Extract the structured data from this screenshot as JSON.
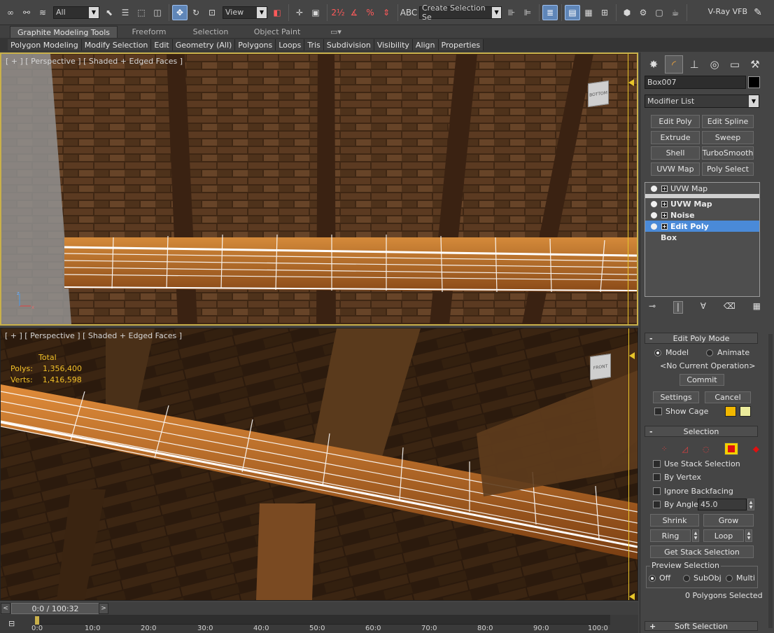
{
  "toolbar": {
    "selection_filter": "All",
    "ref_coord": "View",
    "named_selection_placeholder": "Create Selection Se",
    "vray_label": "V-Ray VFB"
  },
  "ribbon": {
    "tabs": [
      "Graphite Modeling Tools",
      "Freeform",
      "Selection",
      "Object Paint"
    ],
    "tools": [
      "Polygon Modeling",
      "Modify Selection",
      "Edit",
      "Geometry (All)",
      "Polygons",
      "Loops",
      "Tris",
      "Subdivision",
      "Visibility",
      "Align",
      "Properties"
    ]
  },
  "viewports": {
    "top_label": "[ + ] [ Perspective ] [ Shaded + Edged Faces ]",
    "bottom_label": "[ + ] [ Perspective ] [ Shaded + Edged Faces ]",
    "stats": {
      "total": "Total",
      "polys_label": "Polys:",
      "polys_value": "1,356,400",
      "verts_label": "Verts:",
      "verts_value": "1,416,598"
    },
    "top_cube": "BOTTOM",
    "bottom_cube": "FRONT"
  },
  "command_panel": {
    "object_name": "Box007",
    "modifier_list": "Modifier List",
    "modifier_buttons": [
      "Edit Poly",
      "Edit Spline",
      "Extrude",
      "Sweep",
      "Shell",
      "TurboSmooth",
      "UVW Map",
      "Poly Select"
    ],
    "stack": [
      {
        "label": "UVW Map",
        "style": "normal"
      },
      {
        "label": "UVW Map",
        "style": "bold"
      },
      {
        "label": "Noise",
        "style": "bold"
      },
      {
        "label": "Edit Poly",
        "style": "selected"
      },
      {
        "label": "Box",
        "style": "bold"
      }
    ],
    "edit_poly_mode": {
      "title": "Edit Poly Mode",
      "model": "Model",
      "animate": "Animate",
      "operation": "<No Current Operation>",
      "commit": "Commit",
      "settings": "Settings",
      "cancel": "Cancel",
      "show_cage": "Show Cage",
      "cage_colors": [
        "#f2b800",
        "#ecec9c"
      ]
    },
    "selection": {
      "title": "Selection",
      "use_stack": "Use Stack Selection",
      "by_vertex": "By Vertex",
      "ignore_backfacing": "Ignore Backfacing",
      "by_angle": "By Angle:",
      "angle_value": "45.0",
      "shrink": "Shrink",
      "grow": "Grow",
      "ring": "Ring",
      "loop": "Loop",
      "get_stack": "Get Stack Selection",
      "preview_title": "Preview Selection",
      "preview_off": "Off",
      "preview_subobj": "SubObj",
      "preview_multi": "Multi",
      "status": "0 Polygons Selected"
    },
    "soft_selection": "Soft Selection"
  },
  "timeline": {
    "position": "0 / 100",
    "frame_display": "0:0 / 100:32",
    "ticks": [
      "0:0",
      "10:0",
      "20:0",
      "30:0",
      "40:0",
      "50:0",
      "60:0",
      "70:0",
      "80:0",
      "90:0",
      "100:0"
    ]
  }
}
